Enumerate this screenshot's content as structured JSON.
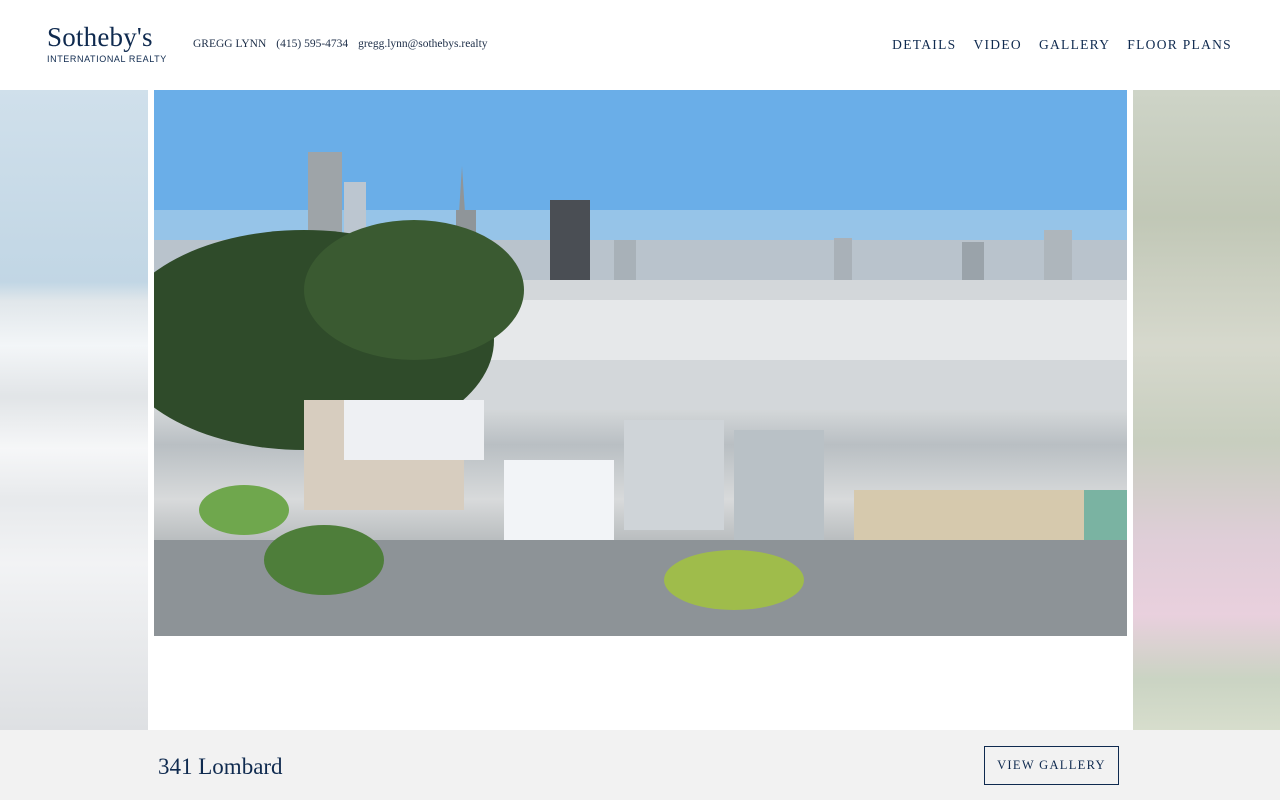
{
  "brand": {
    "name": "Sotheby's",
    "tagline": "INTERNATIONAL REALTY"
  },
  "agent": {
    "name": "GREGG LYNN",
    "phone": "(415) 595-4734",
    "email": "gregg.lynn@sothebys.realty"
  },
  "nav": {
    "items": [
      {
        "label": "DETAILS"
      },
      {
        "label": "VIDEO"
      },
      {
        "label": "GALLERY"
      },
      {
        "label": "FLOOR PLANS"
      }
    ]
  },
  "listing": {
    "title": "341 Lombard",
    "gallery_button": "VIEW GALLERY"
  },
  "colors": {
    "brand_navy": "#0f2a4f",
    "bottom_bar": "#f2f2f2",
    "background": "#ffffff"
  },
  "icons": {
    "photo": "city-skyline-photo"
  }
}
